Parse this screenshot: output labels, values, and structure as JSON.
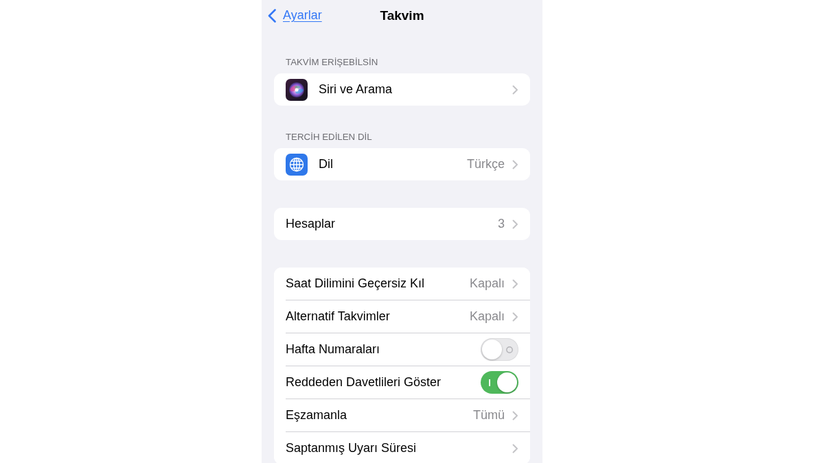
{
  "nav_bar": {
    "back_label": "Ayarlar",
    "title": "Takvim"
  },
  "sections": [
    {
      "header": "TAKVİM ERİŞEBİLSİN",
      "rows": [
        {
          "kind": "siri",
          "label": "Siri ve Arama"
        }
      ]
    },
    {
      "header": "TERCİH EDİLEN DİL",
      "rows": [
        {
          "kind": "language",
          "label": "Dil",
          "value": "Türkçe"
        }
      ]
    },
    {
      "rows": [
        {
          "kind": "link",
          "label": "Hesaplar",
          "value": "3"
        }
      ]
    },
    {
      "rows": [
        {
          "kind": "link",
          "label": "Saat Dilimini Geçersiz Kıl",
          "value": "Kapalı"
        },
        {
          "kind": "link",
          "label": "Alternatif Takvimler",
          "value": "Kapalı"
        },
        {
          "kind": "toggle",
          "label": "Hafta Numaraları",
          "on": false
        },
        {
          "kind": "toggle",
          "label": "Reddeden Davetlileri Göster",
          "on": true
        },
        {
          "kind": "link",
          "label": "Eşzamanla",
          "value": "Tümü"
        },
        {
          "kind": "link",
          "label": "Saptanmış Uyarı Süresi"
        }
      ]
    }
  ]
}
